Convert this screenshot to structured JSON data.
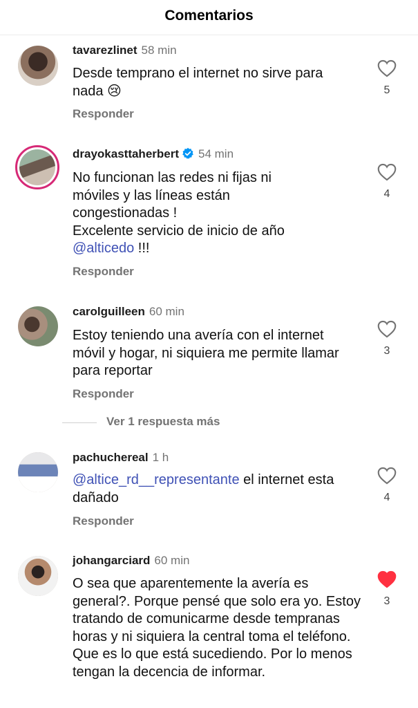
{
  "header": {
    "title": "Comentarios"
  },
  "comments": [
    {
      "username": "tavarezlinet",
      "time": "58 min",
      "text": "Desde temprano el internet no sirve para nada 😢",
      "reply": "Responder",
      "likes": "5",
      "liked": false,
      "verified": false
    },
    {
      "username": "drayokasttaherbert",
      "time": "54 min",
      "text_lines": [
        "No funcionan las redes ni fijas ni",
        "móviles y las líneas están",
        "congestionadas !",
        "Excelente servicio de inicio de año"
      ],
      "mention": "@alticedo",
      "text_suffix": " !!!",
      "reply": "Responder",
      "likes": "4",
      "liked": false,
      "verified": true
    },
    {
      "username": "carolguilleen",
      "time": "60 min",
      "text": "Estoy teniendo una avería con el internet móvil y hogar, ni siquiera me permite llamar para reportar",
      "reply": "Responder",
      "likes": "3",
      "liked": false,
      "verified": false
    },
    {
      "username": "pachuchereal",
      "time": "1 h",
      "mention": "@altice_rd__representante",
      "text_suffix": " el internet esta dañado",
      "reply": "Responder",
      "likes": "4",
      "liked": false,
      "verified": false
    },
    {
      "username": "johangarciard",
      "time": "60 min",
      "text": "O sea que aparentemente la avería es general?. Porque pensé que solo era yo. Estoy tratando de comunicarme desde tempranas horas y ni siquiera la central toma el teléfono. Que es lo que está sucediendo. Por lo menos tengan la decencia de informar.",
      "likes": "3",
      "liked": true,
      "verified": false
    }
  ],
  "more_replies": {
    "label": "Ver 1 respuesta más"
  },
  "colors": {
    "liked": "#ff3040",
    "mention": "#3f51b5",
    "verified": "#0095f6",
    "story_ring": "#d62976"
  },
  "icons": {
    "like": "heart-icon",
    "liked": "heart-filled-icon",
    "verified": "verified-badge-icon"
  }
}
